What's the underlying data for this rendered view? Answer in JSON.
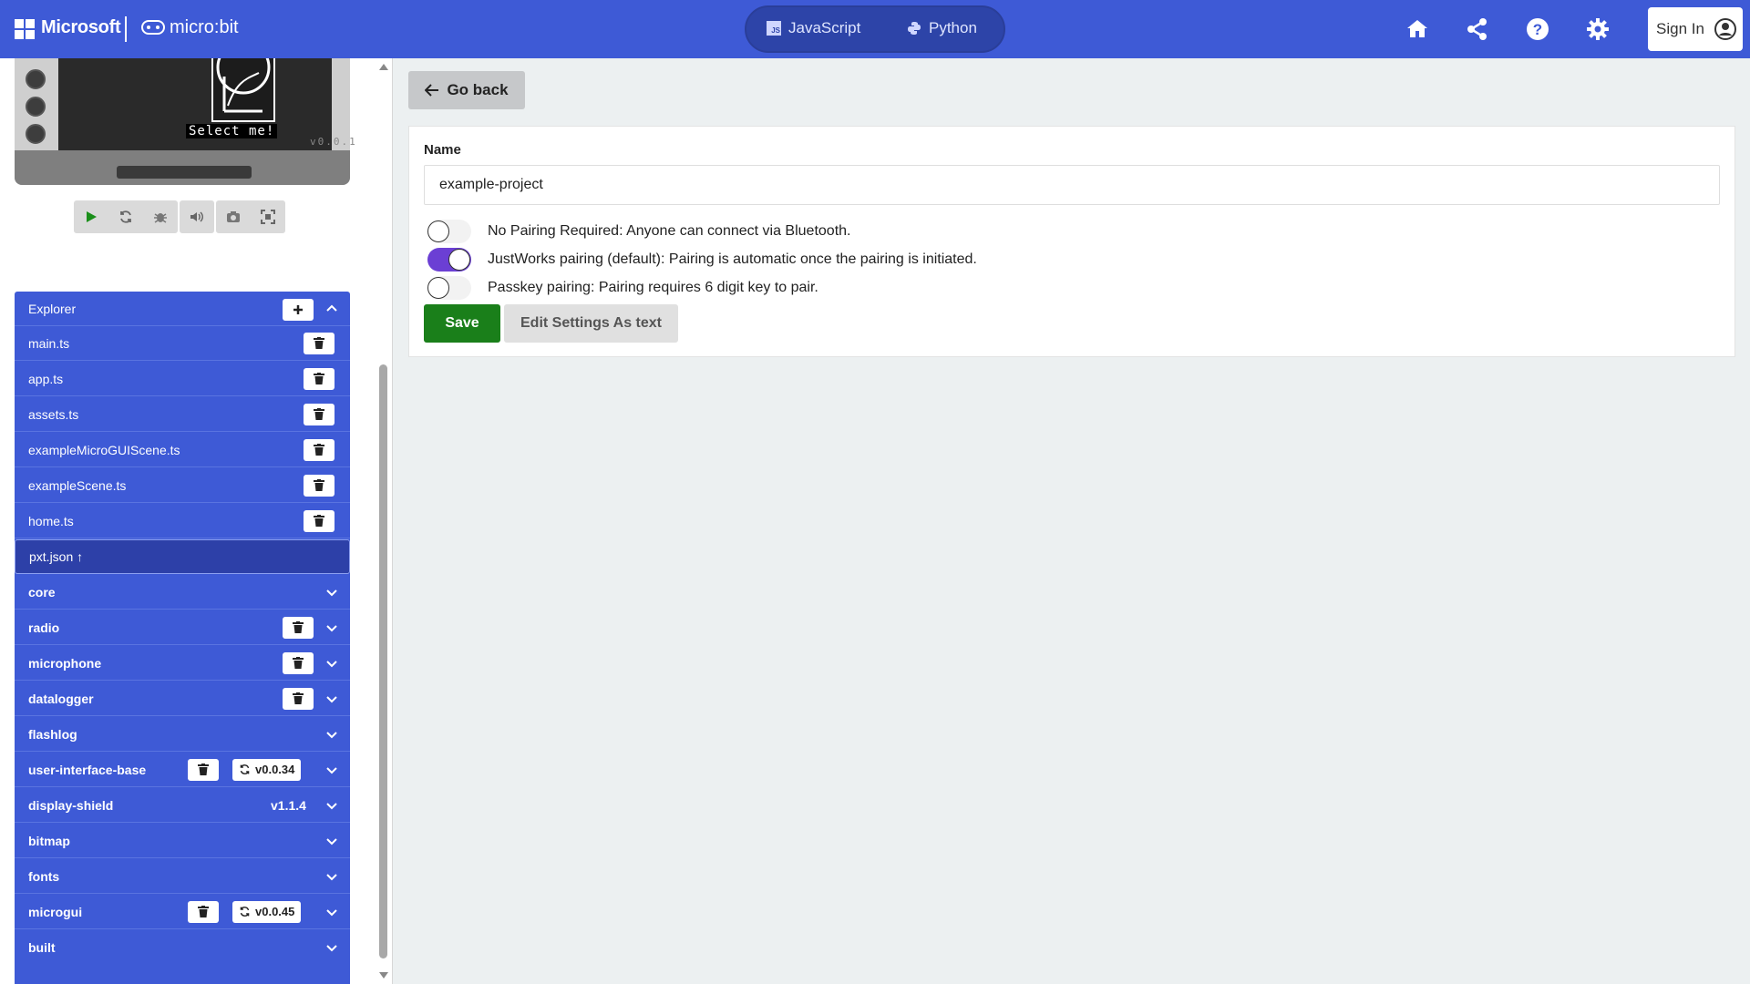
{
  "header": {
    "brand": "Microsoft",
    "product": "micro:bit",
    "lang_js": "JavaScript",
    "lang_py": "Python",
    "sign_in": "Sign In"
  },
  "simulator": {
    "select_text": "Select me!",
    "version": "v0.0.1"
  },
  "explorer": {
    "title": "Explorer",
    "files": [
      {
        "name": "main.ts"
      },
      {
        "name": "app.ts"
      },
      {
        "name": "assets.ts"
      },
      {
        "name": "exampleMicroGUIScene.ts"
      },
      {
        "name": "exampleScene.ts"
      },
      {
        "name": "home.ts"
      },
      {
        "name": "pxt.json ↑"
      }
    ],
    "packages": [
      {
        "name": "core"
      },
      {
        "name": "radio"
      },
      {
        "name": "microphone"
      },
      {
        "name": "datalogger"
      },
      {
        "name": "flashlog"
      },
      {
        "name": "user-interface-base",
        "version": "v0.0.34"
      },
      {
        "name": "display-shield",
        "version": "v1.1.4"
      },
      {
        "name": "bitmap"
      },
      {
        "name": "fonts"
      },
      {
        "name": "microgui",
        "version": "v0.0.45"
      },
      {
        "name": "built"
      }
    ]
  },
  "main": {
    "go_back": "Go back",
    "name_label": "Name",
    "name_value": "example-project",
    "options": [
      {
        "label": "No Pairing Required: Anyone can connect via Bluetooth.",
        "checked": false
      },
      {
        "label": "JustWorks pairing (default): Pairing is automatic once the pairing is initiated.",
        "checked": true
      },
      {
        "label": "Passkey pairing: Pairing requires 6 digit key to pair.",
        "checked": false
      }
    ],
    "save": "Save",
    "edit_as_text": "Edit Settings As text"
  },
  "colors": {
    "header_bg": "#3e5ad6",
    "toggle_on": "#6b3fd4",
    "save_bg": "#1a7f1a"
  }
}
